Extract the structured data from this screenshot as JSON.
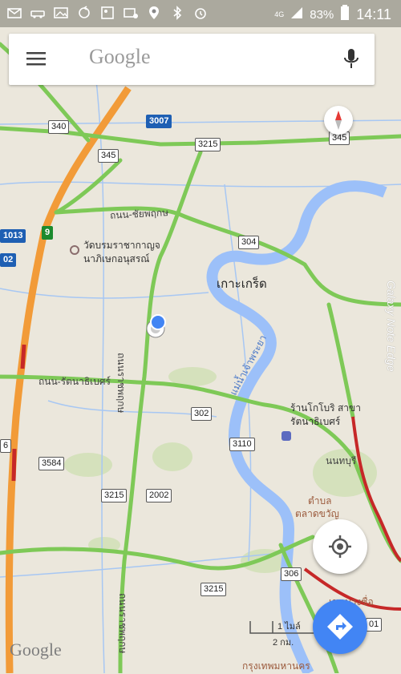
{
  "status_bar": {
    "signal": "4G",
    "battery": "83%",
    "time": "14:11"
  },
  "search": {
    "logo_text": "Google",
    "menu_icon": "hamburger-menu-icon",
    "mic_icon": "microphone-icon"
  },
  "map": {
    "roads": {
      "r340": "340",
      "r3007": "3007",
      "r345": "345",
      "r3215a": "3215",
      "r345b": "345",
      "r9": "9",
      "r1013": "1013",
      "r304": "304",
      "r302": "302",
      "r3110": "3110",
      "r3584": "3584",
      "r3215b": "3215",
      "r2002": "2002",
      "r306": "306",
      "r3215c": "3215",
      "r6": "6",
      "r02": "02",
      "r01": "01"
    },
    "labels": {
      "temple_line1": "วัดบรมราชากาญจ",
      "temple_line2": "นาภิเษกอนุสรณ์",
      "ko_kret": "เกาะเกร็ด",
      "chaiyaphruek": "ถนน-ชัยพฤกษ",
      "rattanathibet": "ถนน-รัตนาธิเบศร์",
      "ratchaphruek": "ถนนราชพฤกษ",
      "chao_phraya": "แม่น้ำเจ้าพระยา",
      "store_line1": "ร้านโกโบริ สาขา",
      "store_line2": "รัตนาธิเบศร์",
      "nonthaburi": "นนทบุรี",
      "tambon": "ตำบล",
      "talat_khwan": "ตลาดขวัญ",
      "ratchaphruek2": "ถนนราชพฤกษ",
      "bang_sue": "เขตบางซื่อ",
      "krungthep": "กรุงเทพมหานคร"
    },
    "scale": {
      "miles": "1 ไมล์",
      "km": "2 กม."
    },
    "watermark": "Galaxy Note Edge"
  },
  "controls": {
    "compass_icon": "compass-icon",
    "locate_icon": "my-location-icon",
    "directions_icon": "directions-icon"
  },
  "footer": {
    "google": "Google"
  }
}
